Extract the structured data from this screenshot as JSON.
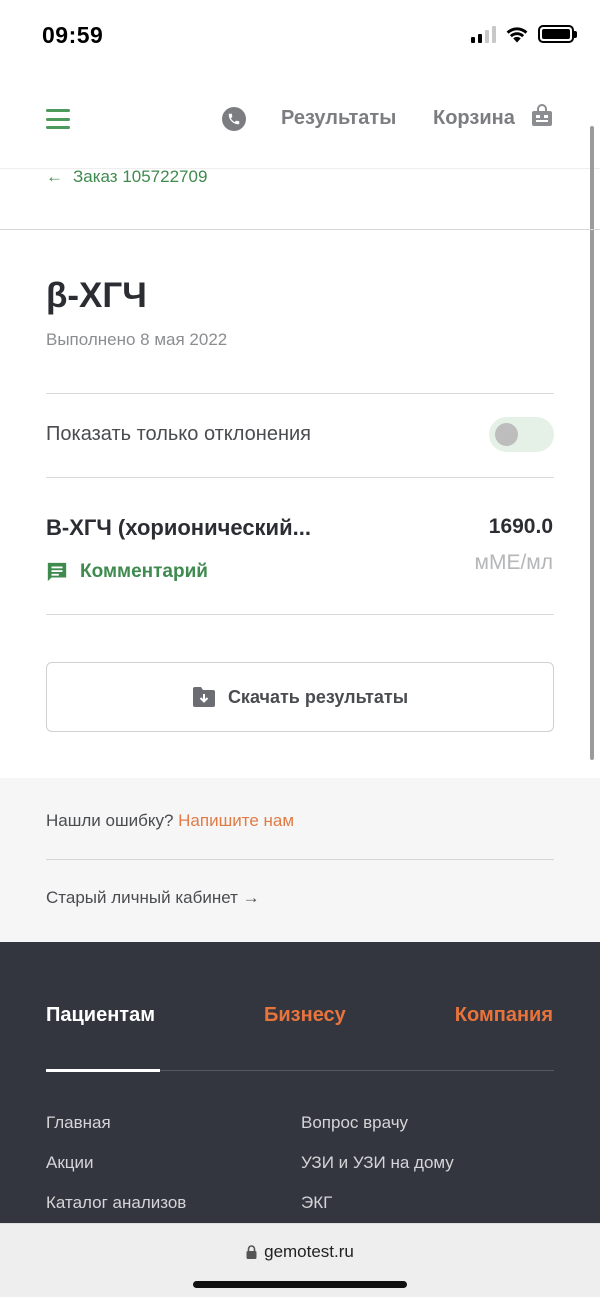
{
  "status": {
    "time": "09:59"
  },
  "header": {
    "results": "Результаты",
    "cart": "Корзина"
  },
  "back": {
    "label": "Заказ 105722709"
  },
  "test": {
    "title": "β-ХГЧ",
    "completed": "Выполнено 8 мая 2022",
    "filter_label": "Показать только отклонения",
    "name": "B-ХГЧ (хорионический...",
    "value": "1690.0",
    "unit": "мМЕ/мл",
    "comment": "Комментарий",
    "download": "Скачать результаты"
  },
  "help": {
    "question": "Нашли ошибку?",
    "write_us": "Напишите нам",
    "old_cabinet": "Старый личный кабинет →"
  },
  "footer": {
    "tabs": [
      "Пациентам",
      "Бизнесу",
      "Компания"
    ],
    "links_left": [
      "Главная",
      "Акции",
      "Каталог анализов"
    ],
    "links_right": [
      "Вопрос врачу",
      "УЗИ и УЗИ на дому",
      "ЭКГ"
    ]
  },
  "browser": {
    "url": "gemotest.ru"
  },
  "colors": {
    "brand_green": "#3f8a4f",
    "accent_orange": "#e8743c",
    "footer_bg": "#33363f"
  }
}
